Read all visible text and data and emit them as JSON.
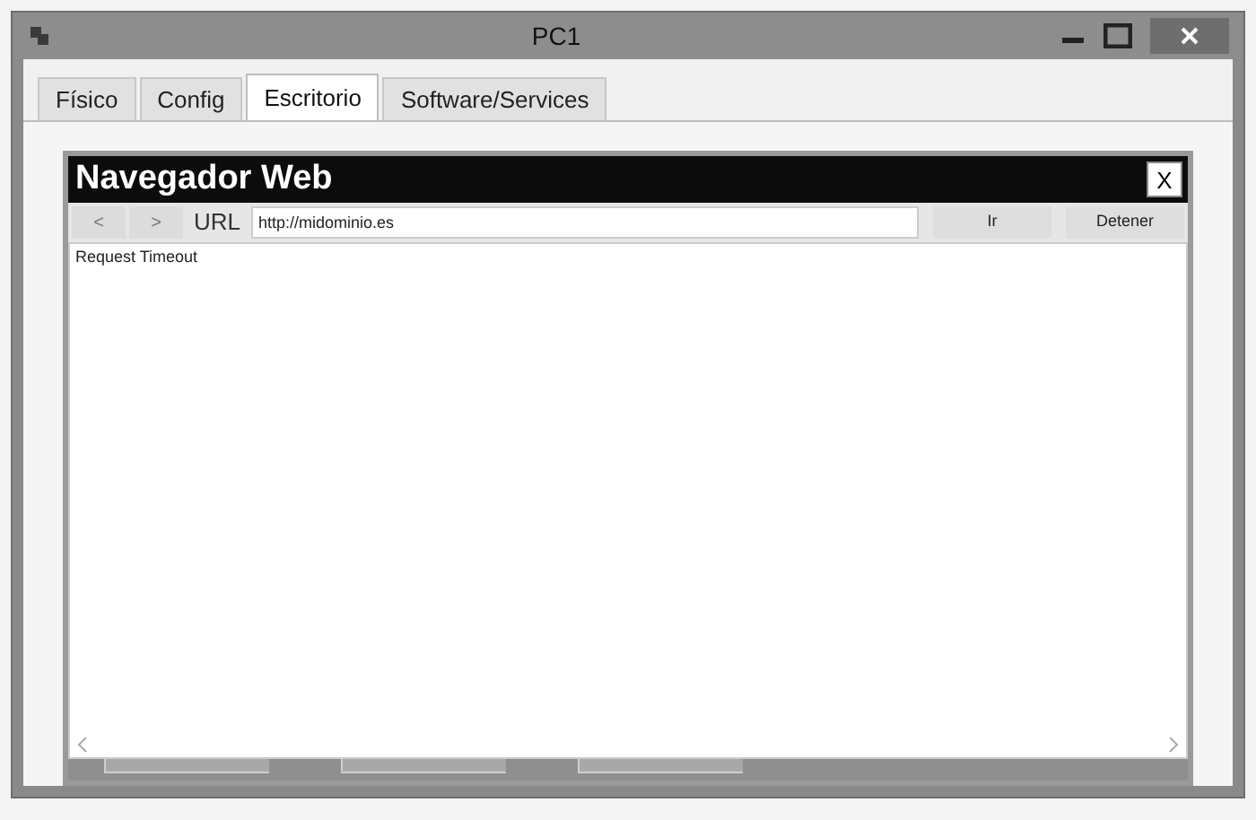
{
  "window": {
    "title": "PC1"
  },
  "tabs": [
    {
      "label": "Físico",
      "selected": false
    },
    {
      "label": "Config",
      "selected": false
    },
    {
      "label": "Escritorio",
      "selected": true
    },
    {
      "label": "Software/Services",
      "selected": false
    }
  ],
  "browser": {
    "title": "Navegador Web",
    "close": "X",
    "back": "<",
    "forward": ">",
    "url_label": "URL",
    "url": "http://midominio.es",
    "go": "Ir",
    "stop": "Detener",
    "content": "Request Timeout"
  }
}
